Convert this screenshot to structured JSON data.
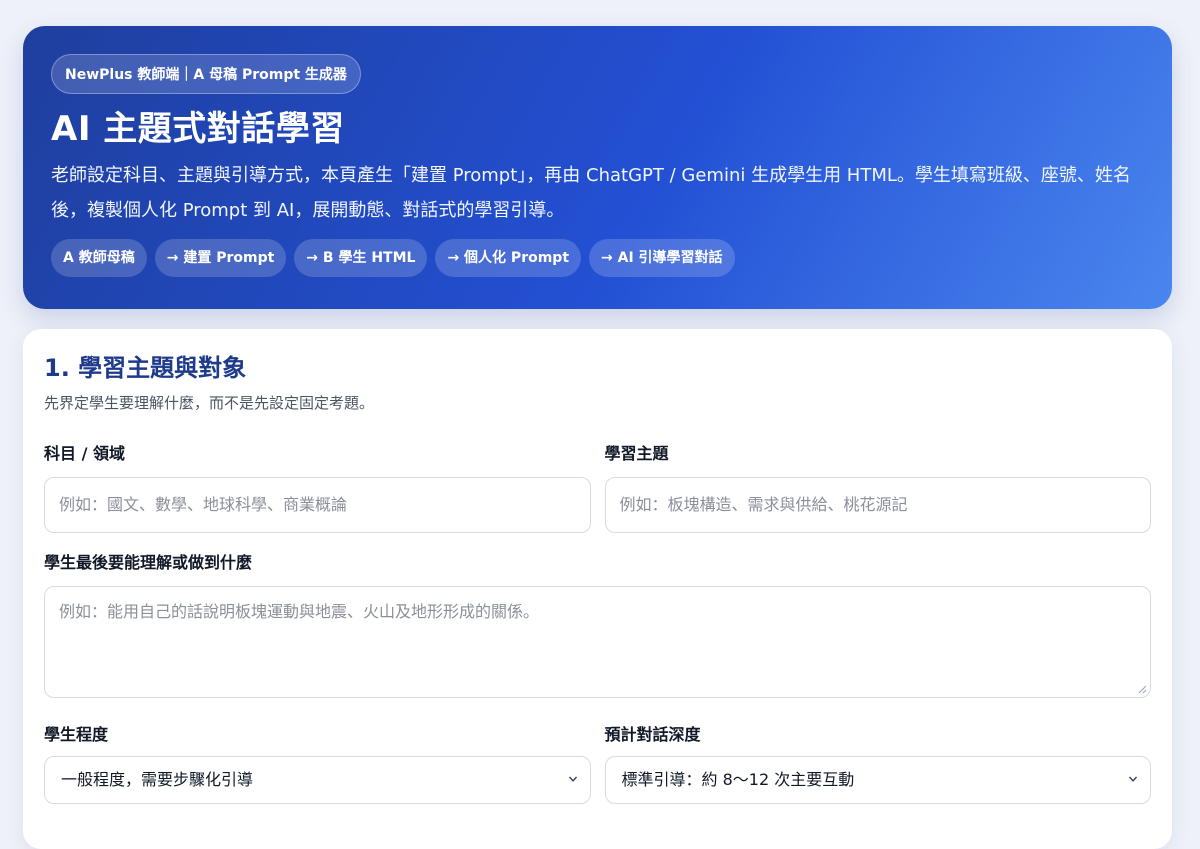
{
  "hero": {
    "badge": "NewPlus 教師端｜A 母稿 Prompt 生成器",
    "title": "AI 主題式對話學習",
    "description": "老師設定科目、主題與引導方式，本頁產生「建置 Prompt」，再由 ChatGPT / Gemini 生成學生用 HTML。學生填寫班級、座號、姓名後，複製個人化 Prompt 到 AI，展開動態、對話式的學習引導。",
    "steps": [
      "A 教師母稿",
      "→ 建置 Prompt",
      "→ B 學生 HTML",
      "→ 個人化 Prompt",
      "→ AI 引導學習對話"
    ]
  },
  "section1": {
    "title": "1. 學習主題與對象",
    "description": "先界定學生要理解什麼，而不是先設定固定考題。",
    "subject": {
      "label": "科目 / 領域",
      "placeholder": "例如：國文、數學、地球科學、商業概論"
    },
    "topic": {
      "label": "學習主題",
      "placeholder": "例如：板塊構造、需求與供給、桃花源記"
    },
    "goal": {
      "label": "學生最後要能理解或做到什麼",
      "placeholder": "例如：能用自己的話說明板塊運動與地震、火山及地形形成的關係。"
    },
    "level": {
      "label": "學生程度",
      "value": "一般程度，需要步驟化引導"
    },
    "depth": {
      "label": "預計對話深度",
      "value": "標準引導：約 8～12 次主要互動"
    }
  },
  "colors": {
    "hero_start": "#1f3f9e",
    "hero_end": "#4a86ef",
    "section_title": "#1e3a8a"
  }
}
